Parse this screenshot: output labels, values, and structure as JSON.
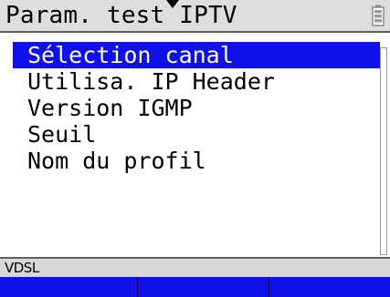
{
  "header": {
    "title": "Param. test IPTV",
    "arrow_icon": "down-arrow-icon",
    "battery_icon": "battery-icon"
  },
  "menu": {
    "items": [
      {
        "label": "Sélection canal",
        "selected": true
      },
      {
        "label": "Utilisa. IP Header",
        "selected": false
      },
      {
        "label": "Version IGMP",
        "selected": false
      },
      {
        "label": "Seuil",
        "selected": false
      },
      {
        "label": "Nom du profil",
        "selected": false
      }
    ]
  },
  "status": {
    "interface": "VDSL"
  },
  "softkeys": {
    "keys": [
      {
        "label": ""
      },
      {
        "label": ""
      },
      {
        "label": ""
      }
    ]
  },
  "colors": {
    "selection": "#1010e8",
    "softkey_bar": "#1010e8",
    "titlebar": "#dedede",
    "statusbar": "#d8d8d8"
  }
}
